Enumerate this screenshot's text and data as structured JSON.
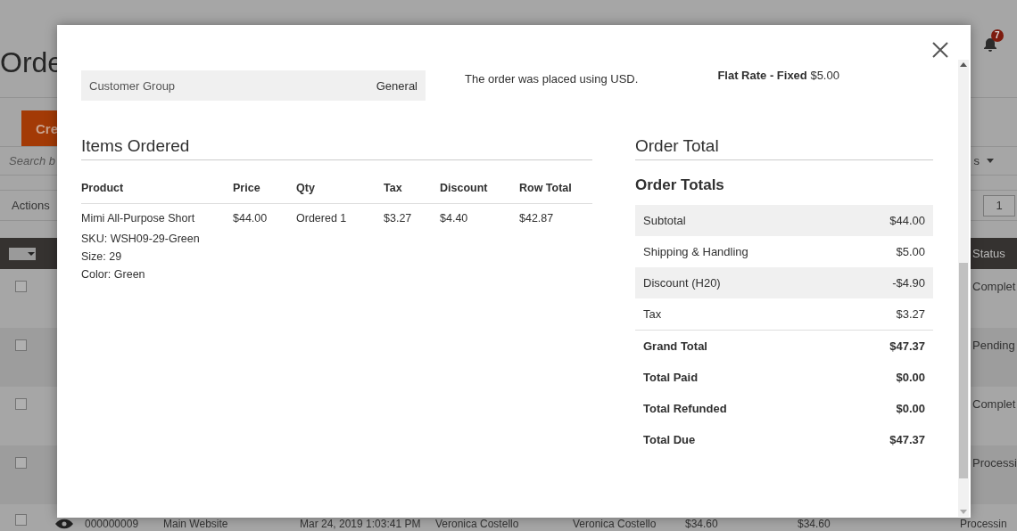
{
  "page": {
    "title": "Orde",
    "notifications": "7",
    "create_button": "Cre",
    "search": {
      "placeholder": "Search b"
    },
    "columns_control": "s",
    "actions": "Actions",
    "page_field": {
      "value": "1"
    },
    "grid": {
      "status_header": "Status",
      "rows": [
        {
          "checked": false,
          "status": "Complet"
        },
        {
          "checked": false,
          "status": "Pending"
        },
        {
          "checked": false,
          "status": "Complet"
        },
        {
          "checked": false,
          "status": "Processi"
        }
      ],
      "last_row": {
        "checked": false,
        "cells": [
          "000000009",
          "Main Website",
          "Mar 24, 2019 1:03:41 PM",
          "Veronica Costello",
          "Veronica Costello",
          "$34.60",
          "$34.60",
          "Processin"
        ]
      }
    }
  },
  "modal": {
    "customer_group": {
      "label": "Customer Group",
      "value": "General"
    },
    "currency_note": "The order was placed using USD.",
    "shipping": "**Flat Rate - Fixed** $5.00",
    "items": {
      "title": "Items Ordered",
      "columns": [
        "Product",
        "Price",
        "Qty",
        "Tax",
        "Discount",
        "Row Total"
      ],
      "rows": [
        {
          "product": "Mimi All-Purpose Short",
          "details": [
            "SKU: WSH09-29-Green",
            "Size: 29",
            "Color: Green"
          ],
          "price": "$44.00",
          "qty": "Ordered 1",
          "tax": "$3.27",
          "discount": "$4.40",
          "row_total": "$42.87"
        }
      ]
    },
    "totals": {
      "title": "Order Total",
      "subtitle": "Order Totals",
      "rows": [
        {
          "label": "Subtotal",
          "value": "$44.00",
          "kind": "plain"
        },
        {
          "label": "Shipping & Handling",
          "value": "$5.00",
          "kind": "plain"
        },
        {
          "label": "Discount (H20)",
          "value": "-$4.90",
          "kind": "plain"
        },
        {
          "label": "Tax",
          "value": "$3.27",
          "kind": "plain"
        },
        {
          "label": "Grand Total",
          "value": "$47.37",
          "kind": "summary"
        },
        {
          "label": "Total Paid",
          "value": "$0.00",
          "kind": "summary"
        },
        {
          "label": "Total Refunded",
          "value": "$0.00",
          "kind": "summary"
        },
        {
          "label": "Total Due",
          "value": "$47.37",
          "kind": "summary"
        }
      ]
    }
  }
}
